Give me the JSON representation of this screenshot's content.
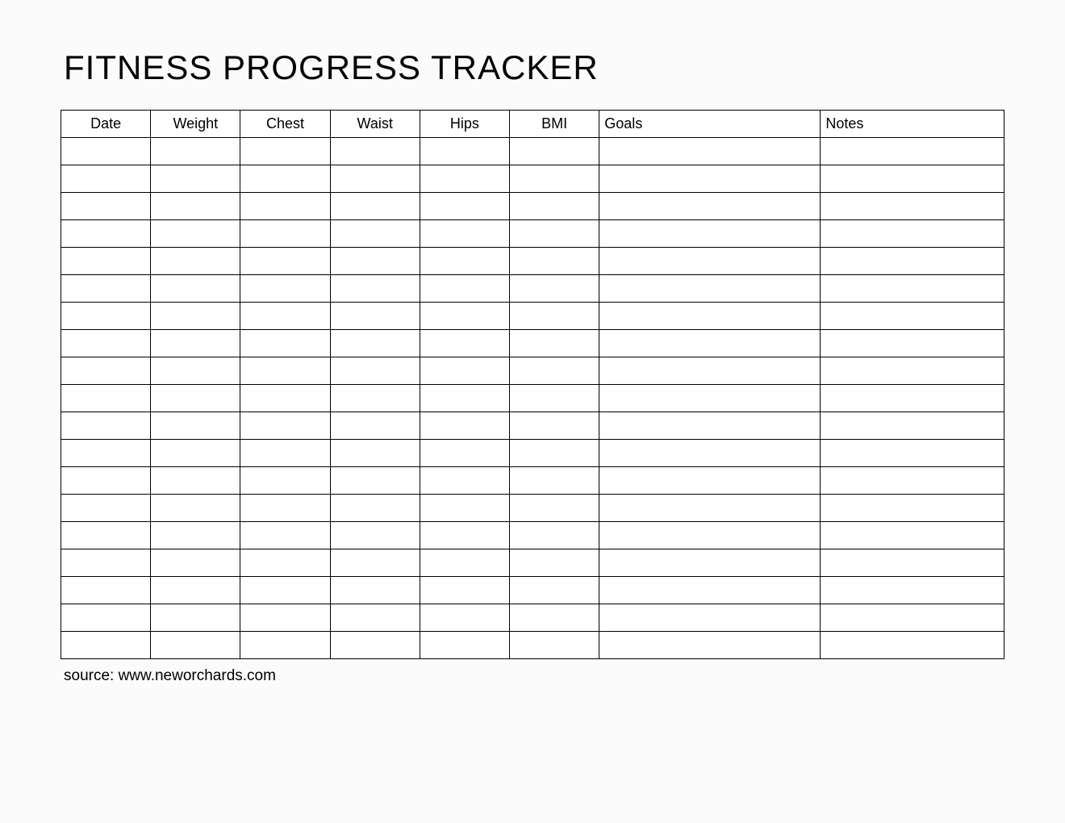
{
  "title": "FITNESS PROGRESS TRACKER",
  "headers": {
    "date": "Date",
    "weight": "Weight",
    "chest": "Chest",
    "waist": "Waist",
    "hips": "Hips",
    "bmi": "BMI",
    "goals": "Goals",
    "notes": "Notes"
  },
  "rowCount": 19,
  "source": "source: www.neworchards.com"
}
